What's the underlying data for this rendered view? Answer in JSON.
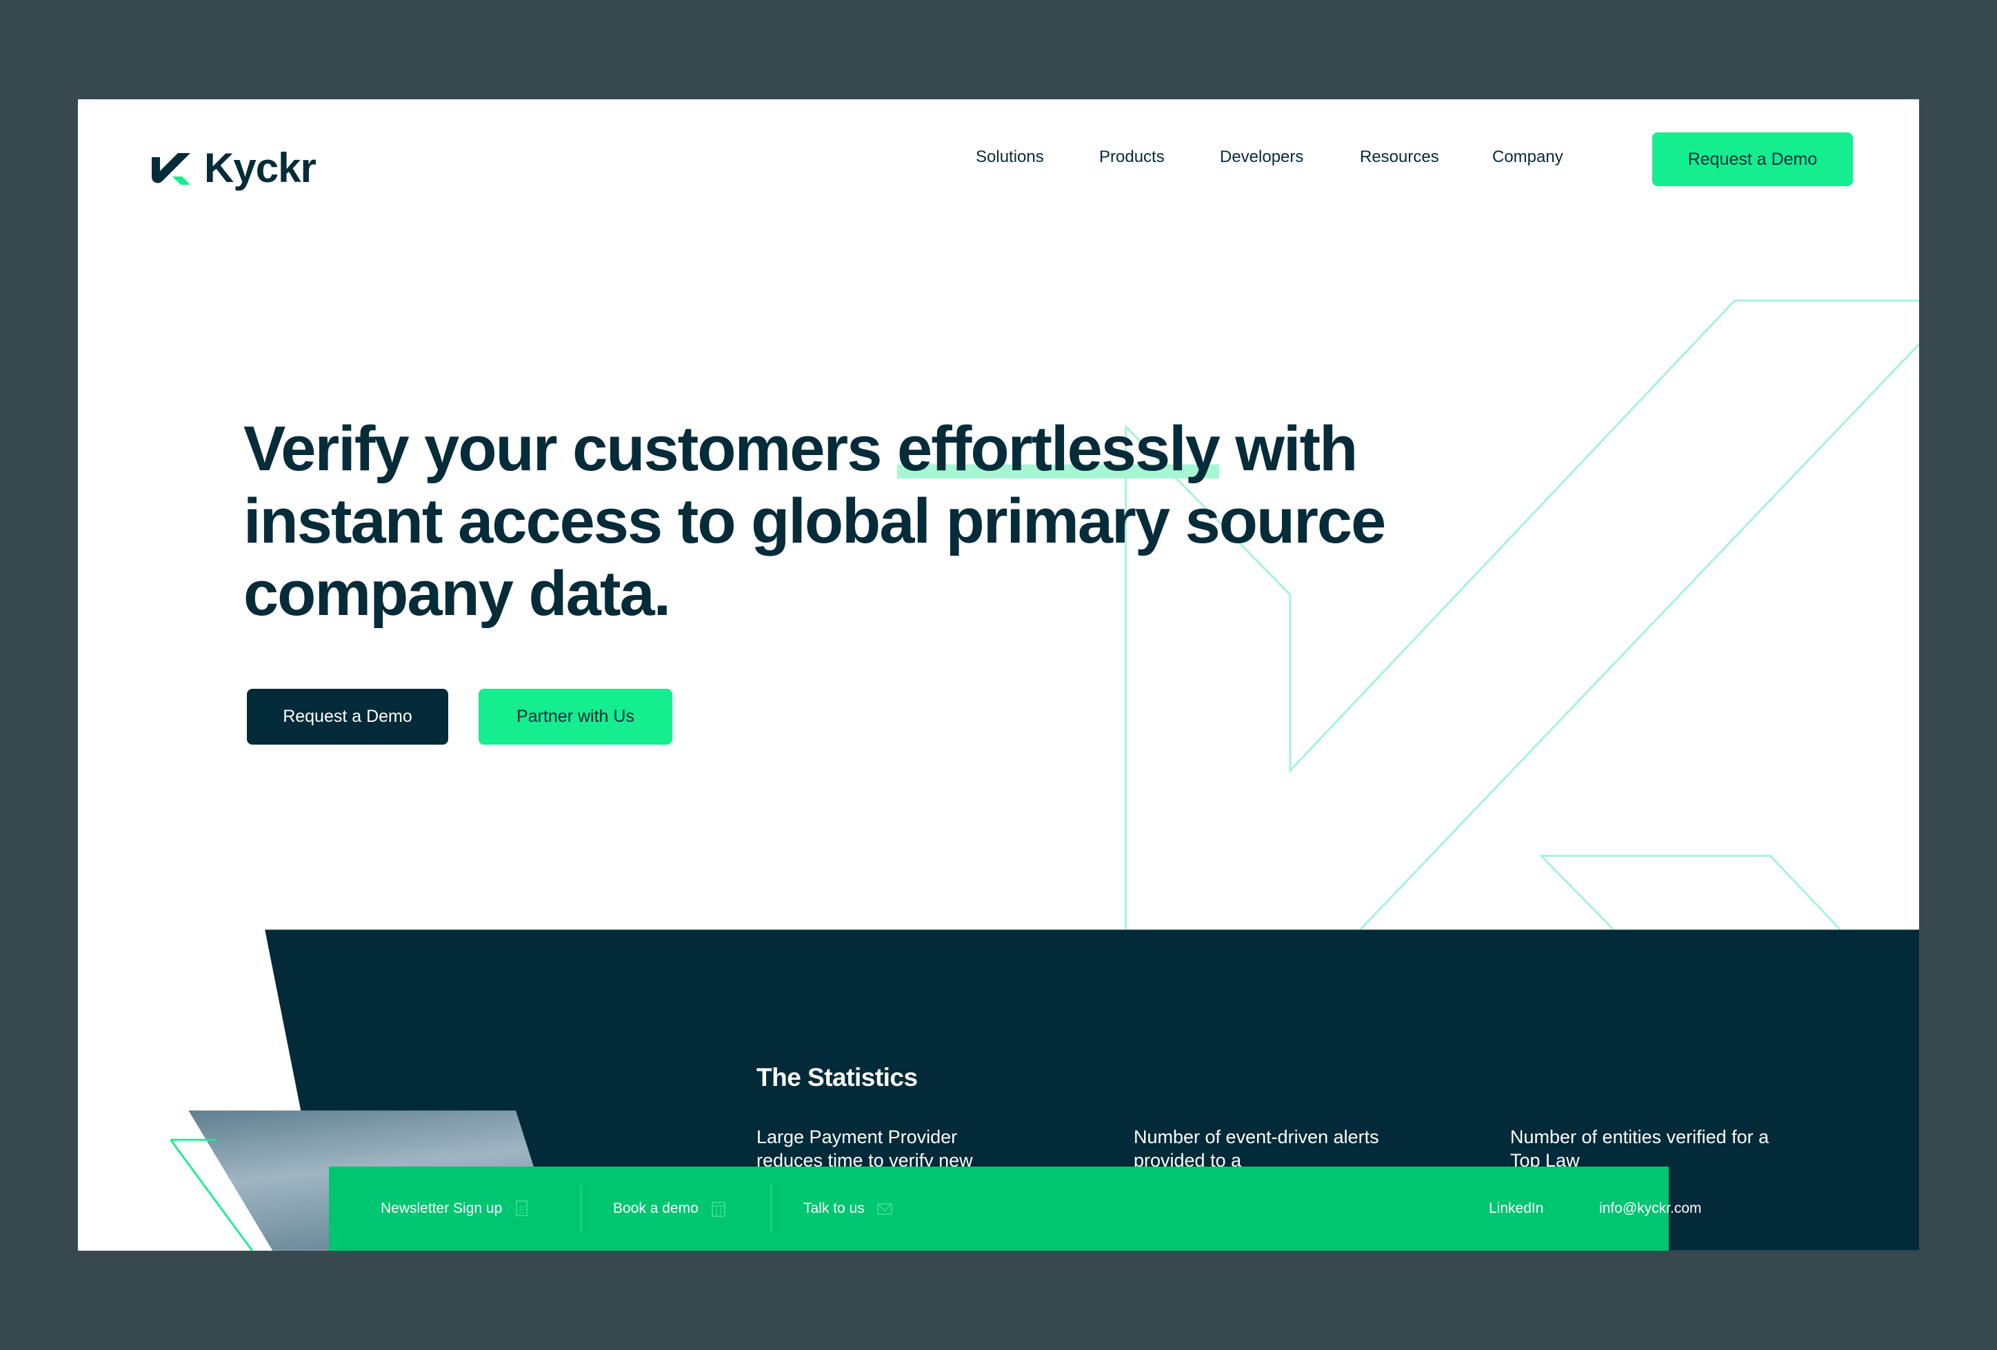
{
  "brand": {
    "name": "Kyckr",
    "colors": {
      "dark": "#032a38",
      "accent": "#14ee8e",
      "bar": "#00c571"
    }
  },
  "nav": {
    "items": [
      "Solutions",
      "Products",
      "Developers",
      "Resources",
      "Company"
    ],
    "cta": "Request a Demo"
  },
  "hero": {
    "title_part1": "Verify your customers ",
    "title_highlight": "effortlessly",
    "title_part2": " with instant access to global primary source company data.",
    "primary_button": "Request a Demo",
    "secondary_button": "Partner with Us"
  },
  "stats": {
    "title": "The Statistics",
    "items": [
      "Large Payment Provider reduces time to verify new",
      "Number of event-driven alerts provided to a",
      "Number of entities verified for a Top Law"
    ]
  },
  "bottom_bar": {
    "newsletter": "Newsletter Sign up",
    "newsletter_icon": "document-icon",
    "demo": "Book a demo",
    "demo_icon": "calendar-icon",
    "talk": "Talk to us",
    "talk_icon": "mail-icon",
    "linkedin": "LinkedIn",
    "email": "info@kyckr.com"
  }
}
